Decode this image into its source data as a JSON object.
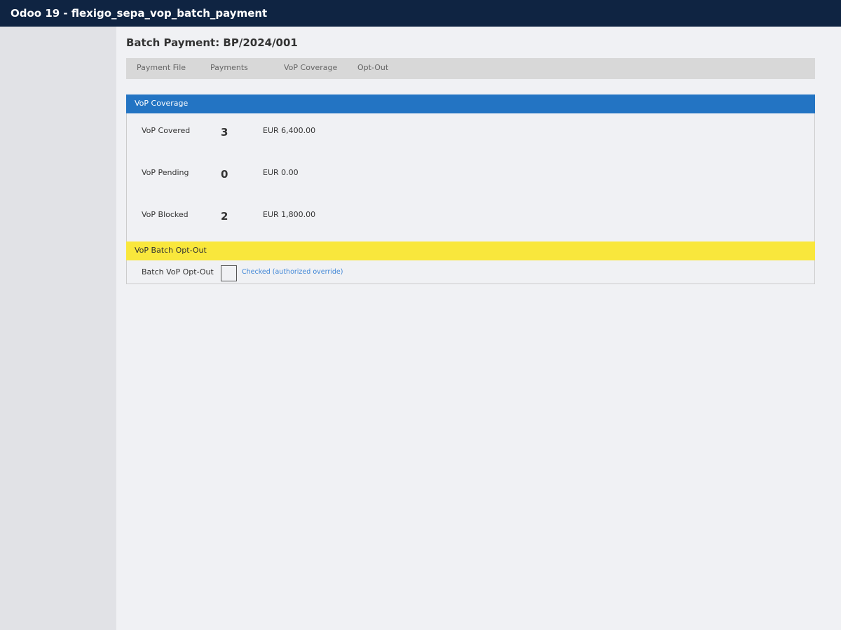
{
  "window": {
    "title": "Odoo 19 - flexigo_sepa_vop_batch_payment"
  },
  "page": {
    "title": "Batch Payment: BP/2024/001"
  },
  "tabs": [
    {
      "label": "Payment File"
    },
    {
      "label": "Payments"
    },
    {
      "label": "VoP Coverage"
    },
    {
      "label": "Opt-Out"
    }
  ],
  "coverage": {
    "header": "VoP Coverage",
    "rows": [
      {
        "label": "VoP Covered",
        "count": "3",
        "amount": "EUR 6,400.00"
      },
      {
        "label": "VoP Pending",
        "count": "0",
        "amount": "EUR 0.00"
      },
      {
        "label": "VoP Blocked",
        "count": "2",
        "amount": "EUR 1,800.00"
      }
    ]
  },
  "optout": {
    "header": "VoP Batch Opt-Out",
    "label": "Batch VoP Opt-Out",
    "checked": false,
    "note": "Checked (authorized override)"
  },
  "colors": {
    "topbar": "#0f2442",
    "coverage_header": "#2374c3",
    "optout_header": "#f9e73c",
    "note_link": "#3f86d6"
  }
}
